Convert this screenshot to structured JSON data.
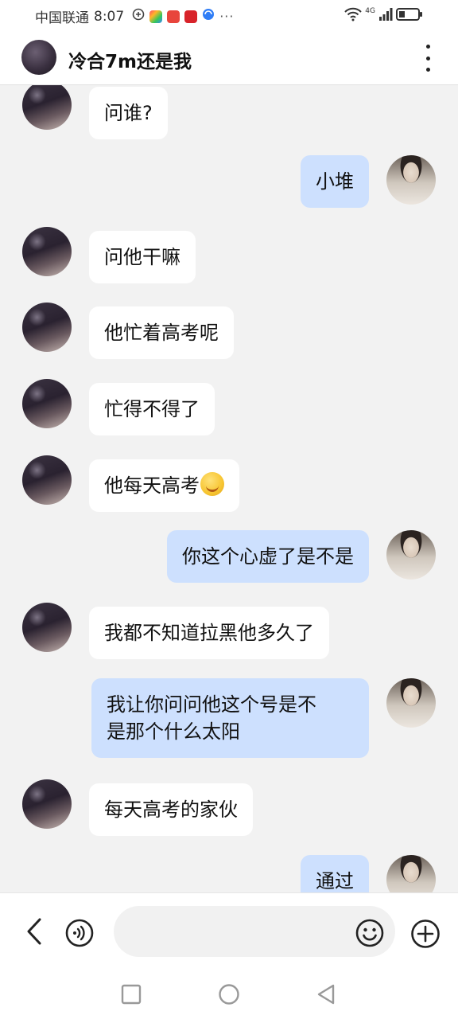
{
  "status_bar": {
    "carrier": "中国联通",
    "time": "8:07",
    "network": "4G",
    "notification_icons": [
      "vpn-icon",
      "app-store-icon",
      "mail-icon",
      "reader-icon",
      "browser-icon"
    ]
  },
  "header": {
    "title": "冷合7m还是我",
    "more_icon": "more-vertical-icon"
  },
  "messages": [
    {
      "from": "other",
      "text": "问谁?"
    },
    {
      "from": "me",
      "text": "小堆"
    },
    {
      "from": "other",
      "text": "问他干嘛"
    },
    {
      "from": "other",
      "text": "他忙着高考呢"
    },
    {
      "from": "other",
      "text": "忙得不得了"
    },
    {
      "from": "other",
      "text": "他每天高考",
      "emoji": "grin-squint-emoji"
    },
    {
      "from": "me",
      "text": "你这个心虚了是不是"
    },
    {
      "from": "other",
      "text": "我都不知道拉黑他多久了"
    },
    {
      "from": "me",
      "text": "我让你问问他这个号是不\n是那个什么太阳"
    },
    {
      "from": "other",
      "text": "每天高考的家伙"
    },
    {
      "from": "me",
      "text": "通过"
    }
  ],
  "input_bar": {
    "placeholder": "",
    "value": ""
  },
  "colors": {
    "my_bubble": "#cde0fe",
    "other_bubble": "#ffffff",
    "background": "#f2f2f2"
  }
}
